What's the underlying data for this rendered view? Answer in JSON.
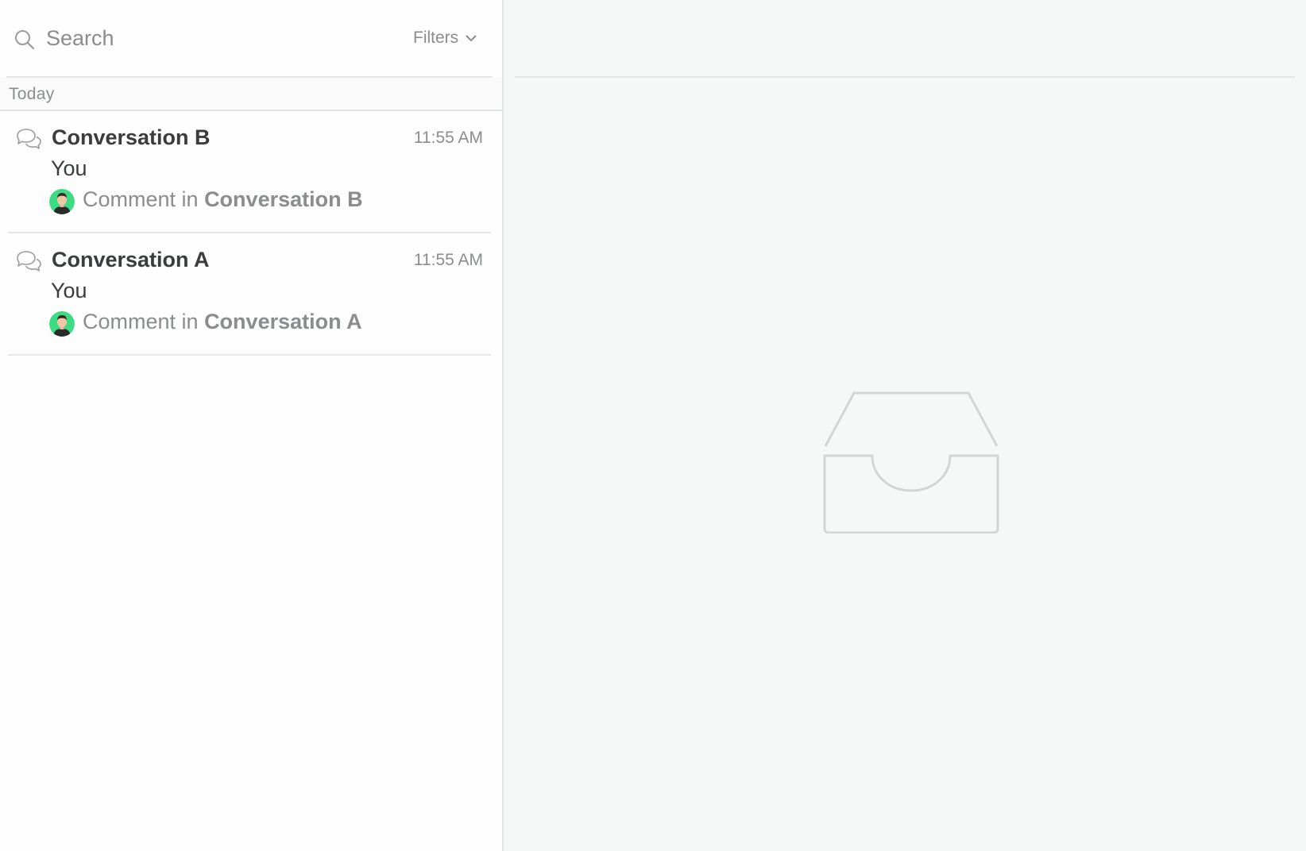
{
  "search": {
    "placeholder": "Search",
    "filters_label": "Filters"
  },
  "section": {
    "label": "Today"
  },
  "conversations": [
    {
      "title": "Conversation B",
      "time": "11:55 AM",
      "author": "You",
      "preview_prefix": "Comment in",
      "preview_target": "Conversation B"
    },
    {
      "title": "Conversation A",
      "time": "11:55 AM",
      "author": "You",
      "preview_prefix": "Comment in",
      "preview_target": "Conversation A"
    }
  ],
  "icons": {
    "search": "search-icon",
    "filters": "chevron-down-icon",
    "conversation": "chat-bubbles-icon",
    "avatar": "user-avatar",
    "empty_state": "empty-inbox-icon"
  },
  "colors": {
    "avatar_ring": "#3ddc84",
    "text_primary": "#3a3c3d",
    "text_muted": "#8a8c8d",
    "divider": "#e4e5e5",
    "icon_stroke": "#d4d6d6"
  }
}
